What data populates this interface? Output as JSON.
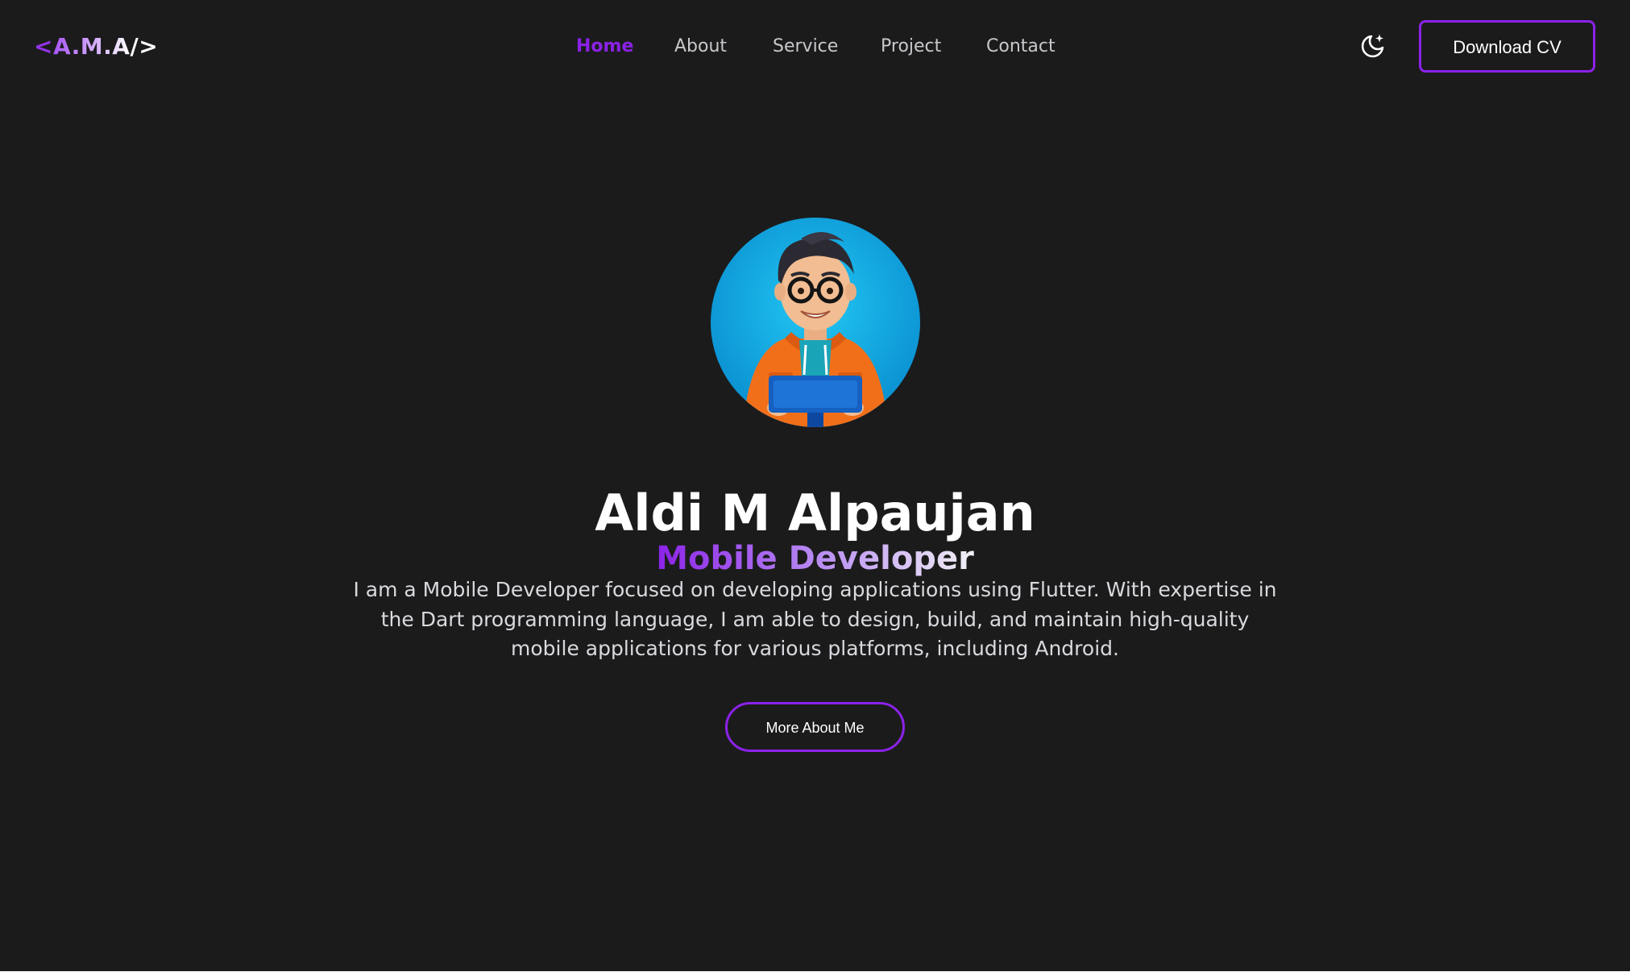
{
  "brand": {
    "logo_open": "<",
    "logo_text": "A.M.A",
    "logo_close": "/>"
  },
  "nav": {
    "items": [
      {
        "label": "Home",
        "active": true
      },
      {
        "label": "About",
        "active": false
      },
      {
        "label": "Service",
        "active": false
      },
      {
        "label": "Project",
        "active": false
      },
      {
        "label": "Contact",
        "active": false
      }
    ],
    "theme_toggle_icon": "moon-star-icon",
    "download_label": "Download CV"
  },
  "hero": {
    "avatar_icon": "developer-avatar",
    "name": "Aldi M Alpaujan",
    "role": "Mobile Developer",
    "description": "I am a Mobile Developer focused on developing applications using Flutter. With expertise in the Dart programming language, I am able to design, build, and maintain high-quality mobile applications for various platforms, including Android.",
    "cta_label": "More About Me"
  },
  "colors": {
    "background": "#1b1b1c",
    "accent": "#8b22e8",
    "text": "#ffffff",
    "muted_text": "#c8c8cc"
  }
}
